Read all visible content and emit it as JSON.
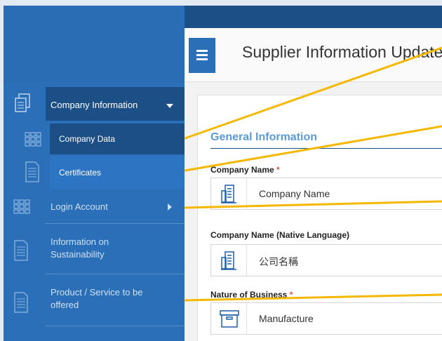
{
  "header": {
    "title": "Supplier Information Update"
  },
  "sidebar": {
    "items": [
      {
        "label": "Company Information"
      },
      {
        "label": "Company Data"
      },
      {
        "label": "Certificates"
      },
      {
        "label": "Login Account"
      },
      {
        "label": "Information on Sustainability"
      },
      {
        "label": "Product / Service to be offered"
      }
    ]
  },
  "form": {
    "section_title": "General Information",
    "required_marker": "*",
    "fields": [
      {
        "label": "Company Name",
        "value": "Company Name",
        "required": true,
        "icon": "building-icon"
      },
      {
        "label": "Company Name (Native Language)",
        "value": "公司名稱",
        "required": false,
        "icon": "building-icon"
      },
      {
        "label": "Nature of Business",
        "value": "Manufacture",
        "required": true,
        "icon": "archive-box-icon"
      }
    ]
  },
  "colors": {
    "sidebar": "#2a6fb8",
    "active": "#1d4f87",
    "annotation_line": "#f5b800",
    "accent": "#5b9bd5"
  }
}
